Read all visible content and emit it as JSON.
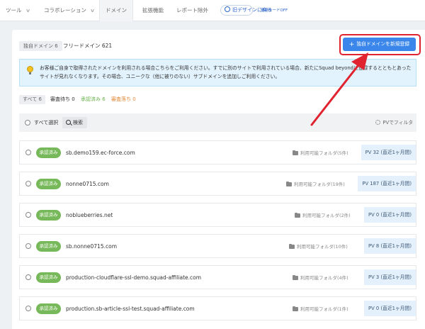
{
  "nav": {
    "items": [
      {
        "label": "ツール",
        "has_chevron": true
      },
      {
        "label": "コラボレーション",
        "has_chevron": true
      },
      {
        "label": "ドメイン",
        "active": true
      },
      {
        "label": "拡張機能"
      },
      {
        "label": "レポート除外"
      }
    ],
    "old_design": "旧デザインに戻る",
    "dev_mode": "開発モードOFF"
  },
  "header": {
    "domain_tag": "独自ドメイン 6",
    "free_domains": "フリードメイン 621",
    "register_button": "独自ドメインを新規登録"
  },
  "notice": {
    "line1": "お客様ご自身で取得されたドメインを利用される場合こちらをご利用ください。すでに別のサイトで利用されている場合、新たにSquad beyondに登録するとともとあったサイトが見れなくなります。その場合、ユニークな（他に被りのない）サブドメインを追加しご利用ください。"
  },
  "filters": {
    "all": "すべて 6",
    "pending": "審査待ち 0",
    "approved": "承認済み 6",
    "rejected": "審査落ち 0"
  },
  "toolbar": {
    "select_all": "すべて選択",
    "search": "検索",
    "pv_filter": "PVでフィルタ"
  },
  "domains": [
    {
      "status": "承認済み",
      "name": "sb.demo159.ec-force.com",
      "folders": "利用可能フォルダ(5件)",
      "pv": "PV 32 (直近1ヶ月間)"
    },
    {
      "status": "承認済み",
      "name": "nonne0715.com",
      "folders": "利用可能フォルダ(19件)",
      "pv": "PV 187 (直近1ヶ月間)"
    },
    {
      "status": "承認済み",
      "name": "noblueberries.net",
      "folders": "利用可能フォルダ(2件)",
      "pv": "PV 0 (直近1ヶ月間)"
    },
    {
      "status": "承認済み",
      "name": "sb.nonne0715.com",
      "folders": "利用可能フォルダ(10件)",
      "pv": "PV 8 (直近1ヶ月間)"
    },
    {
      "status": "承認済み",
      "name": "production-cloudflare-ssl-demo.squad-affiliate.com",
      "folders": "利用可能フォルダ(4件)",
      "pv": "PV 3 (直近1ヶ月間)"
    },
    {
      "status": "承認済み",
      "name": "production.sb-article-ssl-test.squad-affiliate.com",
      "folders": "利用可能フォルダ(1件)",
      "pv": "PV 0 (直近1ヶ月間)"
    }
  ],
  "colors": {
    "accent": "#3a86ea",
    "approved": "#77b95a",
    "highlight": "#e0232f"
  }
}
